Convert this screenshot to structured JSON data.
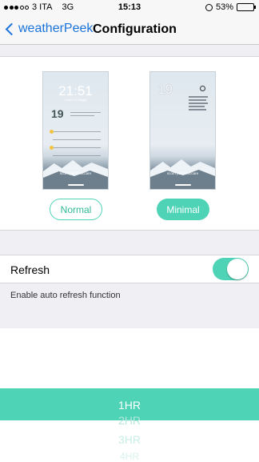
{
  "status_bar": {
    "carrier": "3 ITA",
    "network": "3G",
    "time": "15:13",
    "battery": "53%",
    "battery_level": 0.53
  },
  "nav": {
    "back_label": "weatherPeek",
    "title": "Configuration"
  },
  "previews": {
    "normal": {
      "time": "21:51",
      "date": "Lunedi 10 maggio",
      "day": "19",
      "slide": "scorri per sbloccare"
    },
    "minimal": {
      "day": "19",
      "slide": "scorri per sbloccare"
    }
  },
  "modes": {
    "normal_label": "Normal",
    "minimal_label": "Minimal",
    "selected": "Minimal"
  },
  "refresh": {
    "label": "Refresh",
    "enabled": true,
    "description": "Enable auto refresh function"
  },
  "picker": {
    "items": [
      "1HR",
      "2HR",
      "3HR",
      "4HR"
    ],
    "selected": "1HR"
  },
  "colors": {
    "accent": "#4fd3b6",
    "link": "#1a73d9",
    "background": "#efeff4"
  }
}
